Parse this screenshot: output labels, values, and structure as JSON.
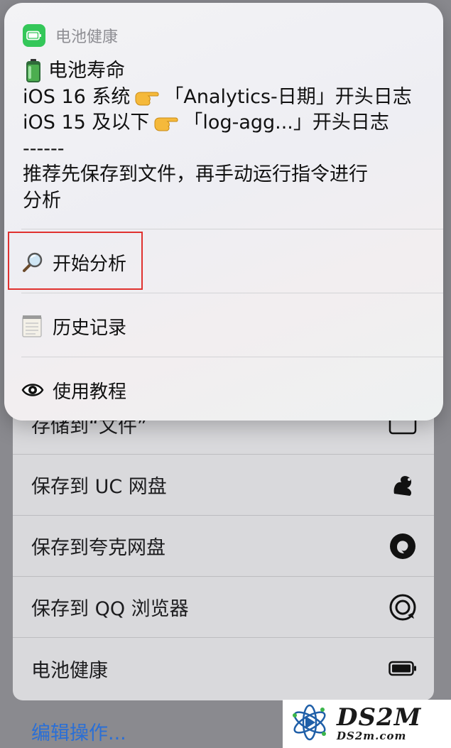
{
  "popup": {
    "app_title": "电池健康",
    "message_lines": [
      "电池寿命",
      "iOS 16 系统",
      "「Analytics-日期」开头日志",
      "iOS 15 及以下",
      "「log-agg...」开头日志",
      "------",
      "推荐先保存到文件，再手动运行指令进行",
      "分析"
    ],
    "menu": [
      {
        "label": "开始分析",
        "icon": "magnifier-icon"
      },
      {
        "label": "历史记录",
        "icon": "notepad-icon"
      },
      {
        "label": "使用教程",
        "icon": "eye-icon"
      }
    ]
  },
  "share_actions": [
    {
      "label": "存储到“文件”",
      "icon": "folder-icon"
    },
    {
      "label": "保存到 UC 网盘",
      "icon": "uc-squirrel-icon"
    },
    {
      "label": "保存到夸克网盘",
      "icon": "quark-icon"
    },
    {
      "label": "保存到 QQ 浏览器",
      "icon": "qq-browser-icon"
    },
    {
      "label": "电池健康",
      "icon": "battery-icon"
    }
  ],
  "edit_actions_label": "编辑操作...",
  "watermark": {
    "brand": "DS2M",
    "domain": "DS2m.com"
  },
  "colors": {
    "accent_link": "#2a6fd6",
    "highlight_border": "#e0312f",
    "app_icon_green": "#34c759"
  }
}
